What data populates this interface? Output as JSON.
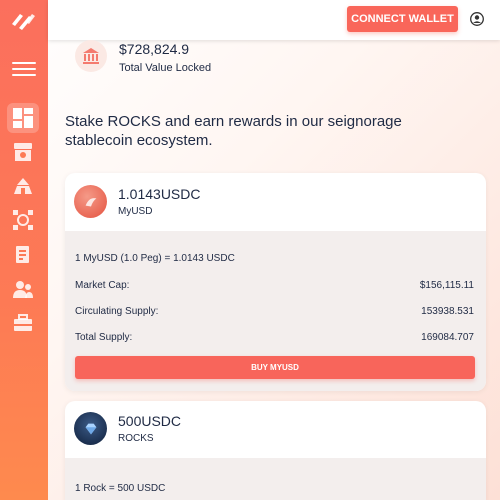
{
  "topbar": {
    "connect_wallet_label": "CONNECT WALLET"
  },
  "sidebar": {
    "items": [
      {
        "name": "dashboard-icon",
        "active": true
      },
      {
        "name": "bank-icon",
        "active": false
      },
      {
        "name": "farm-icon",
        "active": false
      },
      {
        "name": "network-icon",
        "active": false
      },
      {
        "name": "document-icon",
        "active": false
      },
      {
        "name": "people-icon",
        "active": false
      },
      {
        "name": "briefcase-icon",
        "active": false
      }
    ]
  },
  "tvl": {
    "value": "$728,824.9",
    "label": "Total Value Locked"
  },
  "headline": "Stake ROCKS and earn rewards in our seignorage stablecoin ecosystem.",
  "cards": [
    {
      "price": "1.0143USDC",
      "name": "MyUSD",
      "peg": "1 MyUSD (1.0 Peg) = 1.0143 USDC",
      "stats": [
        {
          "label": "Market Cap:",
          "value": "$156,115.11"
        },
        {
          "label": "Circulating Supply:",
          "value": "153938.531"
        },
        {
          "label": "Total Supply:",
          "value": "169084.707"
        }
      ],
      "button_label": "BUY MYUSD"
    },
    {
      "price": "500USDC",
      "name": "ROCKS",
      "peg": "1 Rock = 500 USDC"
    }
  ],
  "colors": {
    "accent": "#f9665a",
    "sidebar_top": "#fb6f5d",
    "sidebar_bottom": "#fe8a4e",
    "text": "#1f2a44"
  }
}
